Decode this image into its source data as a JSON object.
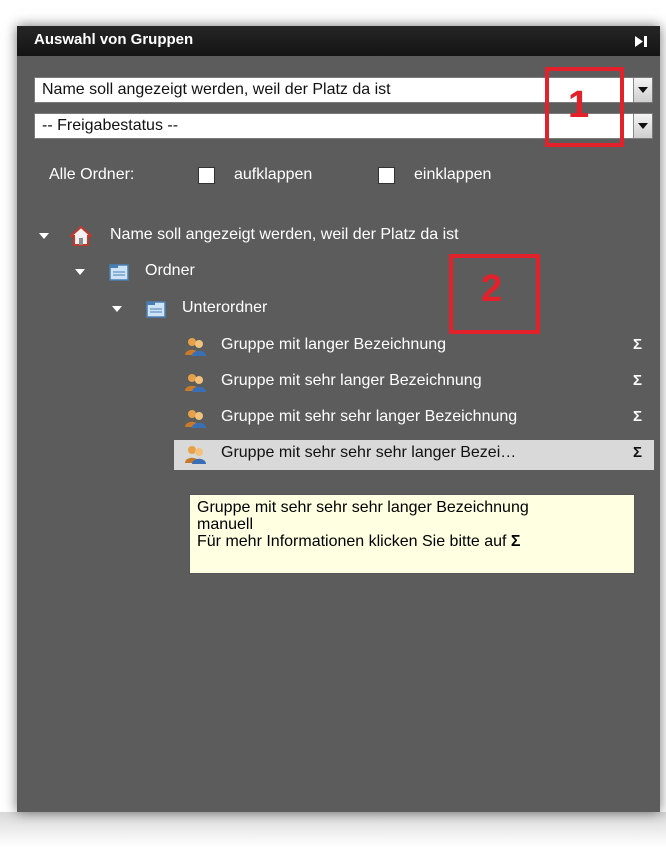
{
  "panel": {
    "title": "Auswahl von Gruppen",
    "collapse_icon": "collapse-right-icon"
  },
  "filters": {
    "project_select": {
      "value": "Name soll angezeigt werden, weil der Platz da ist"
    },
    "status_select": {
      "value": "-- Freigabestatus --"
    }
  },
  "all_folders": {
    "label": "Alle Ordner:",
    "expand_label": "aufklappen",
    "collapse_label": "einklappen"
  },
  "tree": {
    "root": {
      "label": "Name soll angezeigt werden, weil der Platz da ist",
      "icon": "home-icon"
    },
    "folder": {
      "label": "Ordner",
      "icon": "folder-icon"
    },
    "subfolder": {
      "label": "Unterordner",
      "icon": "folder-icon"
    },
    "groups": [
      {
        "label": "Gruppe mit langer Bezeichnung",
        "sigma": "Σ"
      },
      {
        "label": "Gruppe mit sehr langer Bezeichnung",
        "sigma": "Σ"
      },
      {
        "label": "Gruppe mit sehr sehr langer Bezeichnung",
        "sigma": "Σ"
      },
      {
        "label": "Gruppe mit sehr sehr sehr langer Bezei…",
        "sigma": "Σ",
        "selected": true
      }
    ]
  },
  "tooltip": {
    "line1": "Gruppe mit sehr sehr sehr langer Bezeichnung",
    "line2": "manuell",
    "line3_text": "Für mehr Informationen klicken Sie bitte auf ",
    "line3_sigma": "Σ"
  },
  "annotations": [
    {
      "number": "1"
    },
    {
      "number": "2"
    }
  ],
  "colors": {
    "panel_bg": "#5c5c5c",
    "titlebar_bg": "#1e1e1e",
    "tooltip_bg": "#ffffe1",
    "selection_bg": "#d9d9d9",
    "annotation_red": "#e3212a"
  }
}
